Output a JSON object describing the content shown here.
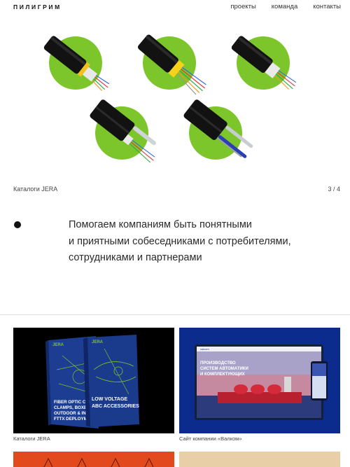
{
  "header": {
    "logo": "ПИЛИГРИМ",
    "nav": [
      "проекты",
      "команда",
      "контакты"
    ]
  },
  "slider": {
    "caption": "Каталоги JERA",
    "counter": "3 / 4"
  },
  "mission": {
    "lines": [
      "Помогаем компаниям быть понятными",
      "и приятными собеседниками с потребителями,",
      "сотрудниками и партнерами"
    ]
  },
  "projects": [
    {
      "label": "Каталоги JERA",
      "booklet_brand": "JERA",
      "booklet_left_lines": [
        "FIBER OPTIC CAB",
        "CLAMPS, BOXES",
        "OUTDOOR & IND",
        "FTTX DEPLOYME"
      ],
      "booklet_right_lines": [
        "LOW VOLTAGE",
        "ABC ACCESSORIES"
      ]
    },
    {
      "label": "Сайт компании «Валком»",
      "site_headline_lines": [
        "ПРОИЗВОДСТВО",
        "СИСТЕМ АВТОМАТИКИ",
        "И КОМПЛЕКТУЮЩИХ"
      ],
      "site_brand": "valcom"
    }
  ],
  "colors": {
    "accent_green": "#7cc52a",
    "catalog_blue": "#1a3a8c",
    "site_blue": "#0b2c8c",
    "orange": "#e24a1e",
    "beige": "#e8cfa8"
  }
}
